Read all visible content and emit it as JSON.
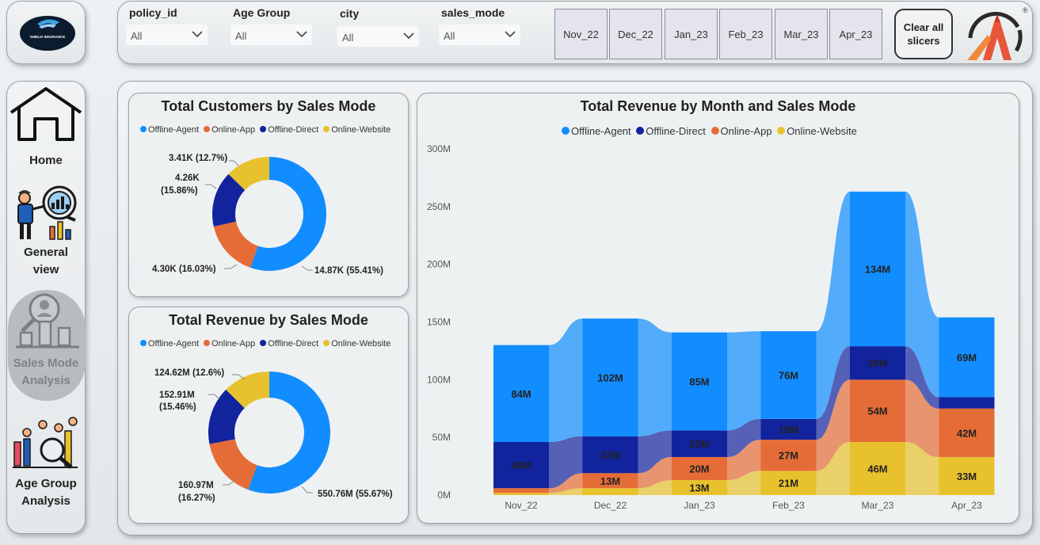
{
  "logo": {
    "text": "SHIELD INSURANCE"
  },
  "slicers": [
    {
      "title": "policy_id",
      "value": "All"
    },
    {
      "title": "Age Group",
      "value": "All"
    },
    {
      "title": "city",
      "value": "All"
    },
    {
      "title": "sales_mode",
      "value": "All"
    }
  ],
  "months": [
    "Nov_22",
    "Dec_22",
    "Jan_23",
    "Feb_23",
    "Mar_23",
    "Apr_23"
  ],
  "clear_button": {
    "line1": "Clear all",
    "line2": "slicers"
  },
  "brand_mark": {
    "registered": "®"
  },
  "nav": {
    "home": "Home",
    "general_line1": "General",
    "general_line2": "view",
    "sales_line1": "Sales Mode",
    "sales_line2": "Analysis",
    "age_line1": "Age Group",
    "age_line2": "Analysis"
  },
  "colors": {
    "offline_agent": "#118dff",
    "online_app": "#e66c37",
    "offline_direct": "#12239e",
    "online_website": "#e8c22d"
  },
  "customers_card": {
    "title": "Total Customers by Sales Mode",
    "legend": [
      "Offline-Agent",
      "Online-App",
      "Offline-Direct",
      "Online-Website"
    ],
    "labels": {
      "website": "3.41K (12.7%)",
      "direct_1": "4.26K",
      "direct_2": "(15.86%)",
      "app": "4.30K (16.03%)",
      "agent": "14.87K (55.41%)"
    }
  },
  "revenue_card": {
    "title": "Total Revenue by Sales Mode",
    "legend": [
      "Offline-Agent",
      "Online-App",
      "Offline-Direct",
      "Online-Website"
    ],
    "labels": {
      "website": "124.62M (12.6%)",
      "direct_1": "152.91M",
      "direct_2": "(15.46%)",
      "app_1": "160.97M",
      "app_2": "(16.27%)",
      "agent": "550.76M (55.67%)"
    }
  },
  "chart_data": [
    {
      "type": "pie",
      "title": "Total Customers by Sales Mode",
      "categories": [
        "Offline-Agent",
        "Online-App",
        "Offline-Direct",
        "Online-Website"
      ],
      "values": [
        14870,
        4300,
        4260,
        3410
      ],
      "percents": [
        55.41,
        16.03,
        15.86,
        12.7
      ]
    },
    {
      "type": "pie",
      "title": "Total Revenue by Sales Mode",
      "categories": [
        "Offline-Agent",
        "Online-App",
        "Offline-Direct",
        "Online-Website"
      ],
      "values": [
        550.76,
        160.97,
        152.91,
        124.62
      ],
      "percents": [
        55.67,
        16.27,
        15.46,
        12.6
      ]
    },
    {
      "type": "bar",
      "title": "Total Revenue by Month and Sales Mode",
      "legend": [
        "Offline-Agent",
        "Offline-Direct",
        "Online-App",
        "Online-Website"
      ],
      "categories": [
        "Nov_22",
        "Dec_22",
        "Jan_23",
        "Feb_23",
        "Mar_23",
        "Apr_23"
      ],
      "y_ticks": [
        "0M",
        "50M",
        "100M",
        "150M",
        "200M",
        "250M",
        "300M"
      ],
      "ylim": [
        0,
        300
      ],
      "series": [
        {
          "name": "Online-Website",
          "values": [
            2,
            6,
            13,
            21,
            46,
            33
          ],
          "labels": [
            "",
            "",
            "13M",
            "21M",
            "46M",
            "33M"
          ]
        },
        {
          "name": "Online-App",
          "values": [
            4,
            13,
            20,
            27,
            54,
            42
          ],
          "labels": [
            "",
            "13M",
            "20M",
            "27M",
            "54M",
            "42M"
          ]
        },
        {
          "name": "Offline-Direct",
          "values": [
            40,
            32,
            23,
            18,
            29,
            10
          ],
          "labels": [
            "40M",
            "32M",
            "23M",
            "18M",
            "29M",
            ""
          ]
        },
        {
          "name": "Offline-Agent",
          "values": [
            84,
            102,
            85,
            76,
            134,
            69
          ],
          "labels": [
            "84M",
            "102M",
            "85M",
            "76M",
            "134M",
            "69M"
          ]
        }
      ]
    }
  ]
}
